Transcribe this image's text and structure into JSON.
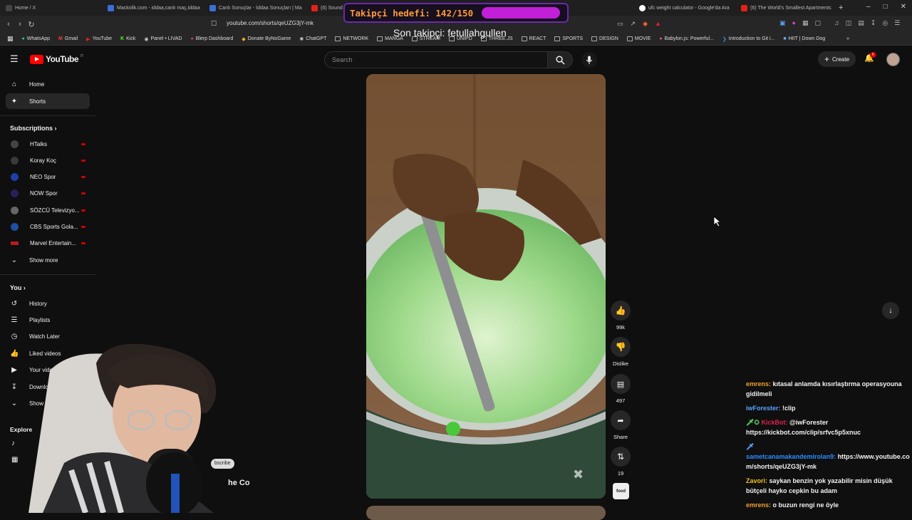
{
  "browser": {
    "tabs": [
      {
        "label": "Home / X",
        "color": "#555555"
      },
      {
        "label": "Mackolik.com - iddaa,canlı maç,iddaa",
        "color": "#3a6fd8"
      },
      {
        "label": "Canlı Sonuçlar - İddaa Sonuçları | Ma",
        "color": "#3a6fd8"
      },
      {
        "label": "(6) Sound",
        "color": "#e62117"
      },
      {
        "label": "ufc weight calculator - Google'da Ara",
        "color": "#ffffff"
      },
      {
        "label": "(6) The World's Smallest Apartments",
        "color": "#e62117"
      }
    ],
    "new_tab": "+",
    "url": "youtube.com/shorts/qeUZG3jY-mk",
    "bookmarks": [
      "WhatsApp",
      "Gmail",
      "YouTube",
      "Kick",
      "Panel • LIVAD",
      "Blerp Dashboard",
      "Donate ByNoGame",
      "ChatGPT",
      "NETWORK",
      "MANGA",
      "STREAM",
      "UNIPD",
      "THREE.JS",
      "REACT",
      "SPORTS",
      "DESIGN",
      "MOVIE",
      "Babylon.js: Powerful...",
      "Introduction to Git i...",
      "HIIT | Down Dog"
    ]
  },
  "header": {
    "logo": "YouTube",
    "country": "IT",
    "search_placeholder": "Search",
    "create_label": "Create",
    "notif_count": "6"
  },
  "sidebar": {
    "main": [
      {
        "label": "Home",
        "icon": "home-icon"
      },
      {
        "label": "Shorts",
        "icon": "shorts-icon"
      }
    ],
    "subscriptions_heading": "Subscriptions",
    "subscriptions": [
      {
        "label": "HTalks",
        "color": "#444444"
      },
      {
        "label": "Koray Koç",
        "color": "#3a3a3a"
      },
      {
        "label": "NEO Spor",
        "color": "#1e3ea8"
      },
      {
        "label": "NOW Spor",
        "color": "#2a1f5a"
      },
      {
        "label": "SÖZCÜ Televizyo...",
        "color": "#666666"
      },
      {
        "label": "CBS Sports Gola...",
        "color": "#1f4fa0"
      },
      {
        "label": "Marvel Entertain...",
        "color": "#c01820"
      }
    ],
    "show_more": "Show more",
    "you_heading": "You",
    "you_items": [
      {
        "label": "History",
        "icon": "history-icon"
      },
      {
        "label": "Playlists",
        "icon": "playlists-icon"
      },
      {
        "label": "Watch Later",
        "icon": "watch-later-icon"
      },
      {
        "label": "Liked videos",
        "icon": "like-icon"
      },
      {
        "label": "Your videos",
        "icon": "video-icon"
      },
      {
        "label": "Downloads",
        "icon": "download-icon"
      }
    ],
    "show_more_2": "Show mo",
    "explore_heading": "Explore"
  },
  "short": {
    "likes": "99k",
    "dislike_label": "Dislike",
    "comments": "497",
    "share_label": "Share",
    "remix_count": "19",
    "channel_badge": "food",
    "subscribe_partial": "bscribe",
    "title_partial": "he Coolest Drink ..."
  },
  "overlay": {
    "goal_text": "Takipçi hedefi: 142/150",
    "goal_progress": 0.947,
    "last_follower": "Son takipçi: fetullahgullen"
  },
  "chat": [
    {
      "user": "emrens:",
      "color": "#f0a030",
      "text": " kıtasal anlamda kısırlaştırma operasyouna gidilmeli"
    },
    {
      "user": "iwForester:",
      "color": "#5aa0ff",
      "text": " !clip"
    },
    {
      "user": "KickBot:",
      "color": "#e0204a",
      "prefix": "🗡✪ ",
      "text": " @iwForester https://kickbot.com/clip/srfvc5p5xnuc"
    },
    {
      "user": "sametcanamakandemirolan9:",
      "color": "#2a8cff",
      "prefix": "🗡 ",
      "text": " https://www.youtube.com/shorts/qeUZG3jY-mk"
    },
    {
      "user": "Zavori:",
      "color": "#f0c020",
      "text": " saykan benzin yok yazabilir misin düşük bütçeli hayko cepkin bu adam"
    },
    {
      "user": "emrens:",
      "color": "#f0a030",
      "text": " o buzun rengi ne öyle"
    }
  ]
}
